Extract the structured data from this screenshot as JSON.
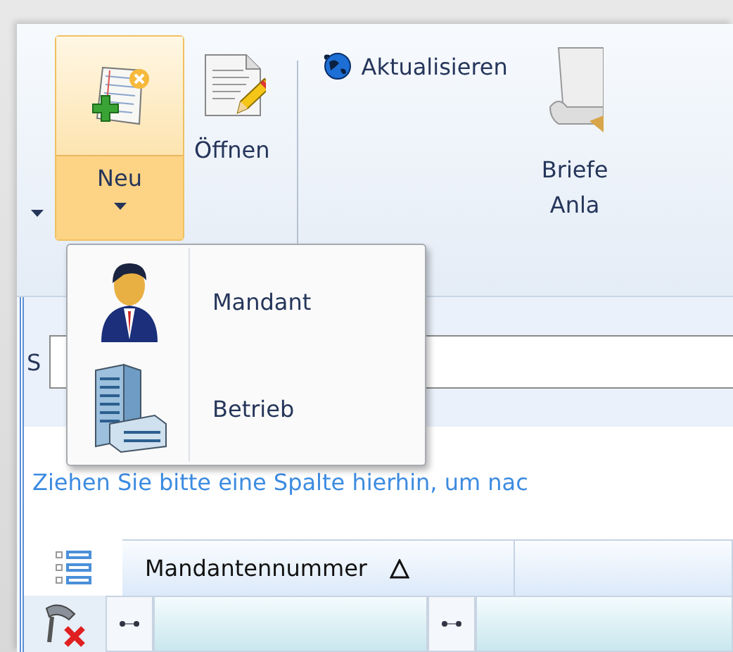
{
  "ribbon": {
    "buttons": [
      {
        "kind": "split",
        "label": "Neu",
        "selected": true
      },
      {
        "kind": "large",
        "label": "Öffnen",
        "selected": false
      },
      {
        "kind": "small",
        "label": "Aktualisieren",
        "selected": false
      },
      {
        "kind": "large",
        "label_lines": [
          "Briefe",
          "Anla"
        ],
        "selected": false
      }
    ]
  },
  "dropdown_menu": {
    "items": [
      {
        "kind": "person",
        "label": "Mandant"
      },
      {
        "kind": "building",
        "label": "Betrieb"
      }
    ]
  },
  "search": {
    "label": "S"
  },
  "group_panel_hint": "Ziehen Sie bitte eine Spalte hierhin, um nac",
  "grid": {
    "columns": [
      {
        "label": "Mandantennummer",
        "sorted_ascending": true
      },
      {
        "sorted_ascending": false
      }
    ]
  }
}
